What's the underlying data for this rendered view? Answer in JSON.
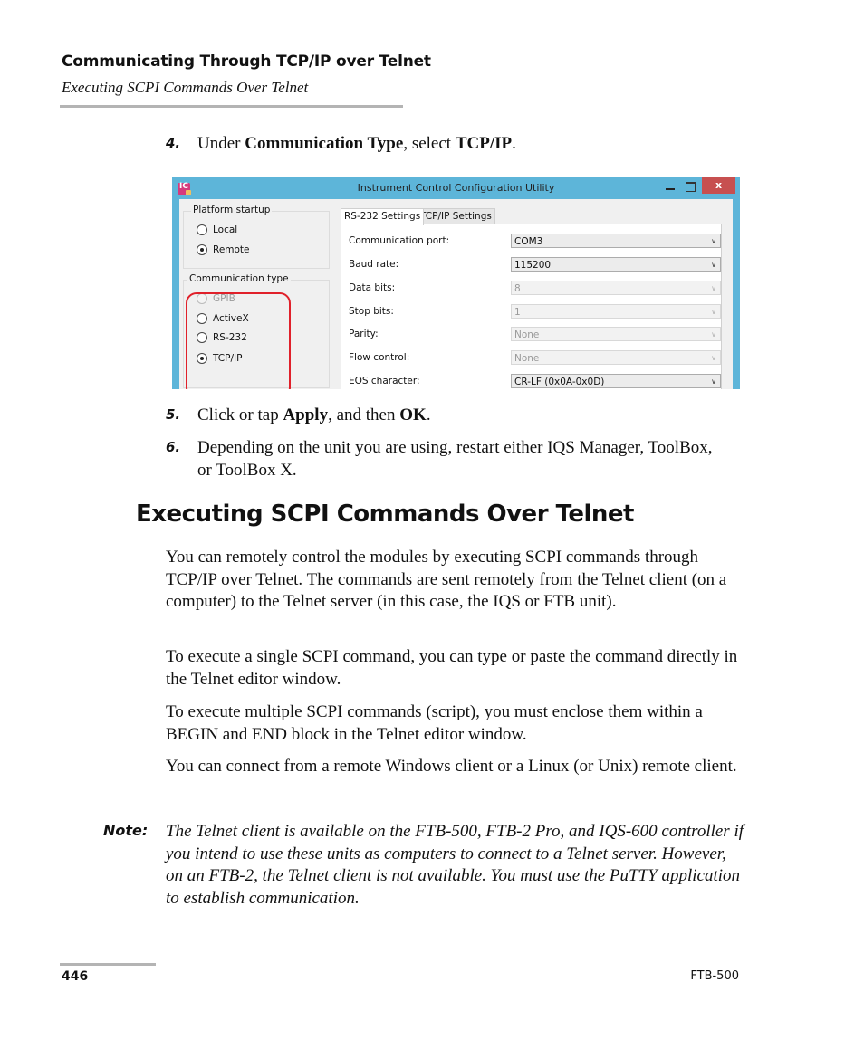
{
  "header": {
    "chapter_title": "Communicating Through TCP/IP over Telnet",
    "section_subtitle": "Executing SCPI Commands Over Telnet"
  },
  "steps": [
    {
      "number": "4.",
      "parts": [
        "Under ",
        "Communication Type",
        ", select ",
        "TCP/IP",
        "."
      ]
    },
    {
      "number": "5.",
      "parts": [
        "Click or tap ",
        "Apply",
        ", and then ",
        "OK",
        "."
      ]
    },
    {
      "number": "6.",
      "text": "Depending on the unit you are using, restart either IQS Manager, ToolBox, or ToolBox X."
    }
  ],
  "window": {
    "title": "Instrument Control Configuration Utility",
    "icon": "ic-app-icon",
    "icon_letters": "IC",
    "controls": {
      "minimize": "minimize-icon",
      "maximize": "maximize-icon",
      "close": "x"
    },
    "platform_startup": {
      "legend": "Platform startup",
      "options": [
        {
          "label": "Local",
          "selected": false,
          "enabled": true
        },
        {
          "label": "Remote",
          "selected": true,
          "enabled": true
        }
      ]
    },
    "communication_type": {
      "legend": "Communication type",
      "options": [
        {
          "label": "GPIB",
          "selected": false,
          "enabled": false
        },
        {
          "label": "ActiveX",
          "selected": false,
          "enabled": true
        },
        {
          "label": "RS-232",
          "selected": false,
          "enabled": true
        },
        {
          "label": "TCP/IP",
          "selected": true,
          "enabled": true
        }
      ]
    },
    "tabs": [
      {
        "label": "RS-232 Settings",
        "active": true
      },
      {
        "label": "TCP/IP Settings",
        "active": false
      }
    ],
    "fields": [
      {
        "label": "Communication port:",
        "value": "COM3",
        "enabled": true
      },
      {
        "label": "Baud rate:",
        "value": "115200",
        "enabled": true
      },
      {
        "label": "Data bits:",
        "value": "8",
        "enabled": false
      },
      {
        "label": "Stop bits:",
        "value": "1",
        "enabled": false
      },
      {
        "label": "Parity:",
        "value": "None",
        "enabled": false
      },
      {
        "label": "Flow control:",
        "value": "None",
        "enabled": false
      },
      {
        "label": "EOS character:",
        "value": "CR-LF (0x0A-0x0D)",
        "enabled": true
      }
    ],
    "colors": {
      "titlebar": "#5db5d9",
      "close_button": "#c75050",
      "highlight_ring": "#e0202a"
    }
  },
  "section": {
    "heading": "Executing SCPI Commands Over Telnet",
    "paragraphs": [
      "You can remotely control the modules by executing SCPI commands through TCP/IP over Telnet. The commands are sent remotely from the Telnet client (on a computer) to the Telnet server (in this case, the IQS or FTB unit).",
      "To execute a single SCPI command, you can type or paste the command directly in the Telnet editor window.",
      "To execute multiple SCPI commands (script), you must enclose them within a BEGIN and END block in the Telnet editor window.",
      "You can connect from a remote Windows client or a Linux (or Unix) remote client."
    ],
    "note_label": "Note:",
    "note_text": "The Telnet client is available on the FTB-500, FTB-2 Pro, and IQS-600 controller if you intend to use these units as computers to connect to a Telnet server. However, on an FTB-2, the Telnet client is not available. You must use the PuTTY application to establish communication."
  },
  "footer": {
    "page_number": "446",
    "product": "FTB-500"
  }
}
